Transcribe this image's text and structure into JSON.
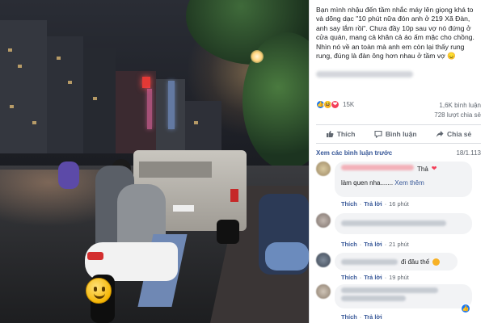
{
  "post": {
    "text": "Bạn mình nhậu đến tầm nhắc máy lên giọng khá to và dõng dạc \"10 phút nữa đón anh ở 219 Xã Đàn, anh say lắm rồi\". Chưa đầy 10p sau vợ nó đứng ở cửa quán, mang cả khăn cả áo ấm mặc cho chồng. Nhìn nó về an toàn mà anh em còn lại thấy rung rung, đúng là đàn ông hơn nhau ở tầm vợ 😞"
  },
  "reactions": {
    "count": "15K",
    "comments": "1,6K bình luận",
    "shares": "728 lượt chia sẻ",
    "icons": [
      "like-icon",
      "haha-icon",
      "love-icon"
    ]
  },
  "actions": {
    "like": "Thích",
    "comment": "Bình luận",
    "share": "Chia sẻ"
  },
  "comments_header": {
    "see_previous": "Xem các bình luận trước",
    "count": "18/1.113"
  },
  "comments": [
    {
      "text": "Thả",
      "heart": "❤",
      "line2": "làm quen nha.......",
      "see_more": "Xem thêm",
      "like": "Thích",
      "reply": "Trả lời",
      "time": "16 phút"
    },
    {
      "like": "Thích",
      "reply": "Trả lời",
      "time": "21 phút"
    },
    {
      "text": "đi đâu thế",
      "like": "Thích",
      "reply": "Trả lời",
      "time": "19 phút"
    },
    {
      "like": "Thích",
      "reply": "Trả lời"
    }
  ],
  "colors": {
    "fb_blue": "#385898",
    "like_blue": "#1877f2",
    "love_red": "#f33e58",
    "haha_yellow": "#f7b125",
    "meta_gray": "#606770"
  }
}
